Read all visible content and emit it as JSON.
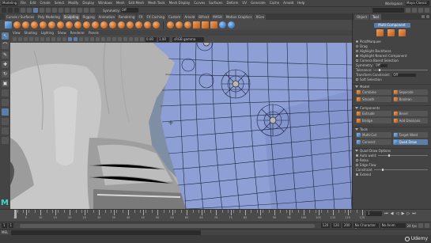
{
  "menubar": {
    "mode": "Modeling",
    "items": [
      "File",
      "Edit",
      "Create",
      "Select",
      "Modify",
      "Display",
      "Windows",
      "Mesh",
      "Edit Mesh",
      "Mesh Tools",
      "Mesh Display",
      "Curves",
      "Surfaces",
      "Deform",
      "UV",
      "Generate",
      "Cache",
      "Arnold",
      "Help"
    ],
    "workspace_label": "Workspace:",
    "workspace": "Maya Classic"
  },
  "statusline": {
    "symmetry_label": "Symmetry:",
    "symmetry": "Off",
    "user_field": ""
  },
  "shelf_tabs": [
    "Curves / Surfaces",
    "Poly Modeling",
    "Sculpting",
    "Rigging",
    "Animation",
    "Rendering",
    "FX",
    "FX Caching",
    "Custom",
    "Arnold",
    "Bifrost",
    "MASH",
    "Motion Graphics",
    "XGen"
  ],
  "shelf_active_index": 2,
  "viewport": {
    "panel_menu": [
      "View",
      "Shading",
      "Lighting",
      "Show",
      "Renderer",
      "Panels"
    ],
    "gamma": "0.00",
    "exposure": "1.00",
    "color_space": "sRGB gamma"
  },
  "attribute_panel": {
    "tabs": [
      "Object",
      "Tool"
    ],
    "active_tab": 1,
    "mode_label": "Multi-Component",
    "selection_options": [
      {
        "label": "Pick/Marquee",
        "on": true
      },
      {
        "label": "Drag",
        "on": false
      },
      {
        "label": "Highlight Backfaces",
        "on": false
      },
      {
        "label": "Highlight Nearest Component",
        "on": true
      }
    ],
    "camera_based": "Camera Based Selection",
    "symmetry_label": "Symmetry:",
    "symmetry_value": "Off",
    "tolerance_label": "Tolerance:",
    "tolerance_value": "",
    "transform_label": "Transform Constraint:",
    "transform_value": "Off",
    "soft_selection": "Soft Selection",
    "sections": {
      "model": "Model",
      "components": "Components",
      "tools": "Tools",
      "quad_draw": "Quad Draw Options"
    },
    "model_buttons": [
      "Combine",
      "Separate",
      "Smooth",
      "Boolean"
    ],
    "component_buttons": [
      "Extrude",
      "Bevel",
      "Bridge",
      "Add Divisions"
    ],
    "tool_buttons": [
      "Multi-Cut",
      "Target Weld",
      "Connect",
      "Quad Draw"
    ],
    "quad_draw_options": {
      "auto_weld_label": "Auto weld:",
      "auto_weld": "",
      "relax_label": "Relax",
      "edge_flow": "Edge Flow",
      "constraint": "Constraint",
      "extend": "Extend"
    }
  },
  "time_slider": {
    "tick_labels": [
      "1",
      "5",
      "10",
      "15",
      "20",
      "25",
      "30",
      "35",
      "40",
      "45",
      "50",
      "55",
      "60",
      "65",
      "70",
      "75",
      "80",
      "85",
      "90",
      "95",
      "100",
      "105",
      "110",
      "115",
      "120"
    ],
    "current_frame": "1"
  },
  "range_slider": {
    "start": "1",
    "inner_start": "1",
    "inner_end": "120",
    "end": "120",
    "end2": "200",
    "character_set": "No Character Set",
    "anim_layer": "No Anim Layer",
    "fps": "24 fps"
  },
  "command_line": {
    "mel_label": "MEL"
  },
  "watermark": "Udemy"
}
